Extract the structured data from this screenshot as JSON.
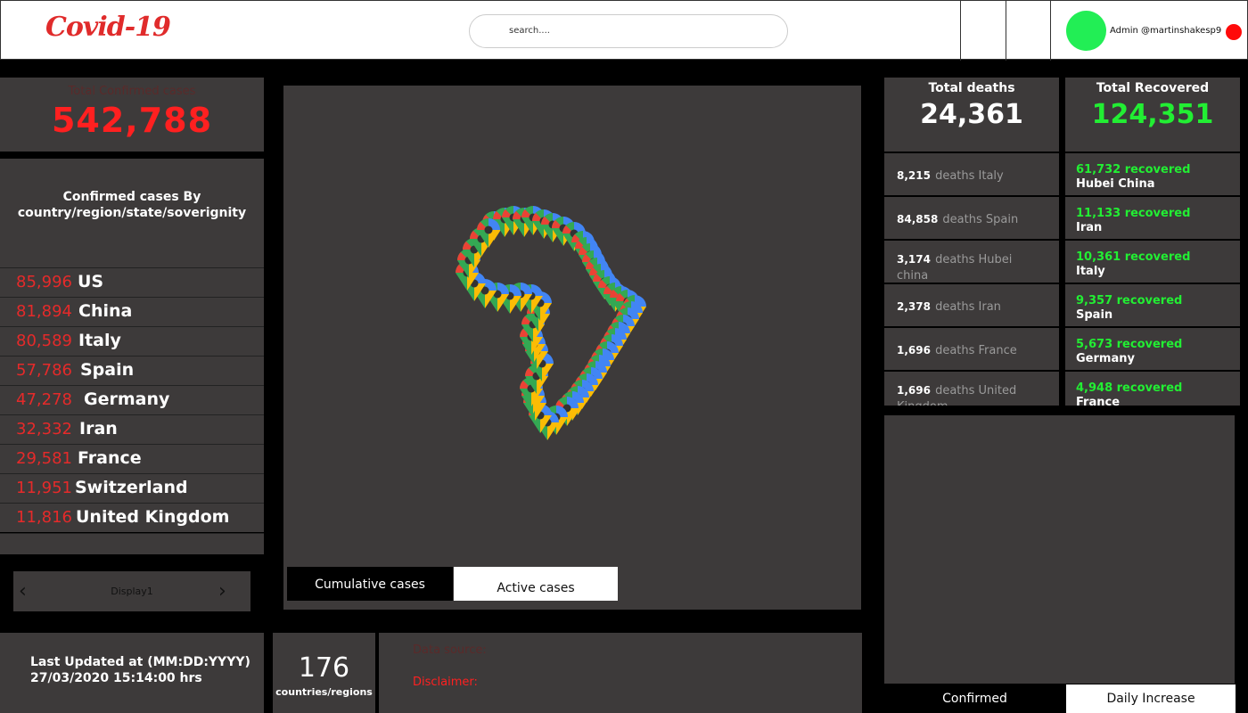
{
  "header": {
    "logo": "Covid-19",
    "search_placeholder": "search....",
    "admin_label": "Admin @martinshakesp9"
  },
  "total_confirmed": {
    "label": "Total Confirmed cases",
    "value": "542,788"
  },
  "by_country": {
    "title_line1": "Confirmed cases By",
    "title_line2": "country/region/state/soverignity",
    "rows": [
      {
        "num": "85,996",
        "name": "US"
      },
      {
        "num": "81,894",
        "name": "China"
      },
      {
        "num": "80,589",
        "name": "Italy"
      },
      {
        "num": "57,786",
        "name": "Spain"
      },
      {
        "num": "47,278",
        "name": "Germany"
      },
      {
        "num": "32,332",
        "name": "Iran"
      },
      {
        "num": "29,581",
        "name": "France"
      },
      {
        "num": "11,951",
        "name": "Switzerland"
      },
      {
        "num": "11,816",
        "name": "United Kingdom"
      }
    ]
  },
  "pager": {
    "label": "Display1",
    "prev": "‹",
    "next": "›"
  },
  "last_updated": {
    "line1": "Last Updated at (MM:DD:YYYY)",
    "line2": "27/03/2020 15:14:00 hrs"
  },
  "countries": {
    "value": "176",
    "label": "countries/regions"
  },
  "data_source": {
    "source_label": "Data source:",
    "disclaimer_label": "Disclaimer:"
  },
  "map": {
    "tabs": [
      {
        "label": "Cumulative cases",
        "active": true
      },
      {
        "label": "Active cases",
        "active": false
      }
    ],
    "pin_colors": [
      "#4285f4",
      "#ea4335",
      "#fbbc05",
      "#34a853"
    ]
  },
  "deaths": {
    "title": "Total deaths",
    "value": "24,361",
    "rows": [
      {
        "num": "8,215",
        "text": "deaths Italy"
      },
      {
        "num": "84,858",
        "text": "deaths Spain"
      },
      {
        "num": "3,174",
        "text": "deaths Hubei china"
      },
      {
        "num": "2,378",
        "text": "deaths Iran"
      },
      {
        "num": "1,696",
        "text": "deaths France"
      },
      {
        "num": "1,696",
        "text": "deaths United Kingdom"
      }
    ]
  },
  "recovered": {
    "title": "Total Recovered",
    "value": "124,351",
    "rows": [
      {
        "num": "61,732 recovered",
        "place": "Hubei China"
      },
      {
        "num": "11,133 recovered",
        "place": "Iran"
      },
      {
        "num": "10,361 recovered",
        "place": "Italy"
      },
      {
        "num": "9,357 recovered",
        "place": "Spain"
      },
      {
        "num": "5,673 recovered",
        "place": "Germany"
      },
      {
        "num": "4,948 recovered",
        "place": "France"
      }
    ]
  },
  "bottom_tabs": [
    {
      "label": "Confirmed",
      "active": true
    },
    {
      "label": "Daily Increase",
      "active": false
    }
  ],
  "colors": {
    "panel": "#3d3a3a",
    "accent_red": "#ff2020",
    "accent_green": "#22ee33",
    "avatar": "#22ee55"
  }
}
